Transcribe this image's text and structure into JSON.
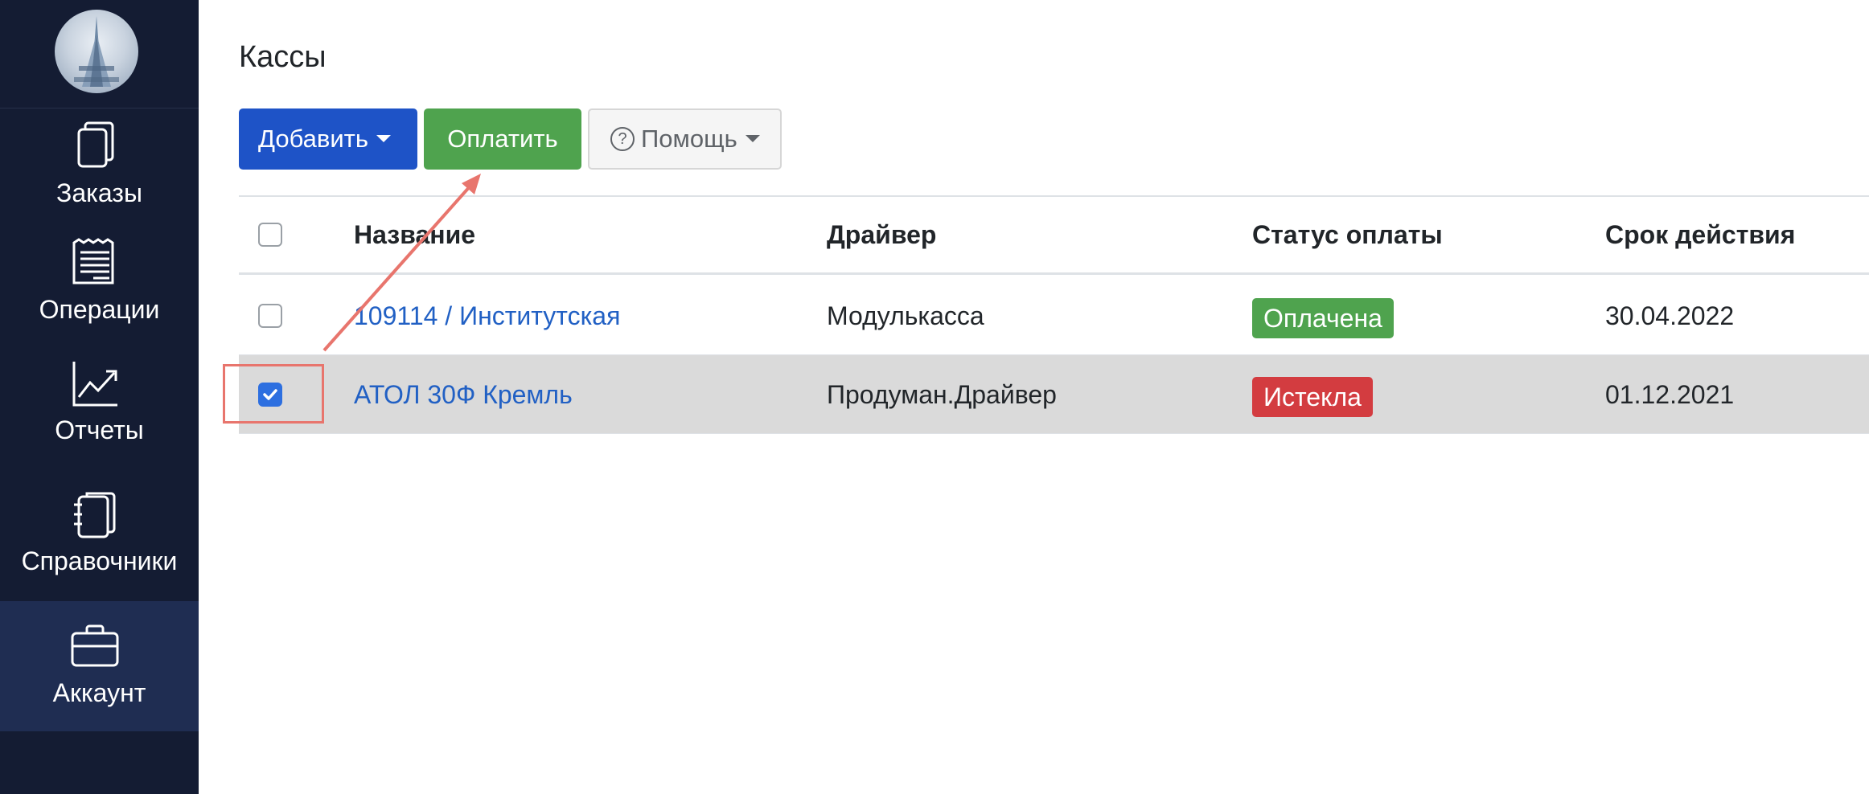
{
  "sidebar": {
    "items": [
      {
        "label": "Заказы",
        "icon": "orders-icon"
      },
      {
        "label": "Операции",
        "icon": "receipt-icon"
      },
      {
        "label": "Отчеты",
        "icon": "chart-line-icon"
      },
      {
        "label": "Справочники",
        "icon": "notebook-icon"
      },
      {
        "label": "Аккаунт",
        "icon": "briefcase-icon",
        "active": true
      }
    ]
  },
  "page": {
    "title": "Кассы"
  },
  "toolbar": {
    "add_label": "Добавить",
    "pay_label": "Оплатить",
    "help_label": "Помощь",
    "help_icon_glyph": "?"
  },
  "table": {
    "headers": {
      "name": "Название",
      "driver": "Драйвер",
      "payment_status": "Статус оплаты",
      "valid_until": "Срок действия"
    },
    "rows": [
      {
        "name": "109114 / Институтская",
        "driver": "Модулькасса",
        "status": "Оплачена",
        "status_kind": "paid",
        "valid_until": "30.04.2022",
        "checked": false
      },
      {
        "name": "АТОЛ 30Ф Кремль",
        "driver": "Продуман.Драйвер",
        "status": "Истекла",
        "status_kind": "expired",
        "valid_until": "01.12.2021",
        "checked": true
      }
    ]
  },
  "colors": {
    "sidebar_bg": "#141c33",
    "sidebar_active_bg": "#1f2d52",
    "primary": "#1e53c7",
    "success": "#4fa34e",
    "danger": "#d33c40",
    "link": "#2160c4",
    "annotation": "#e8756d"
  }
}
